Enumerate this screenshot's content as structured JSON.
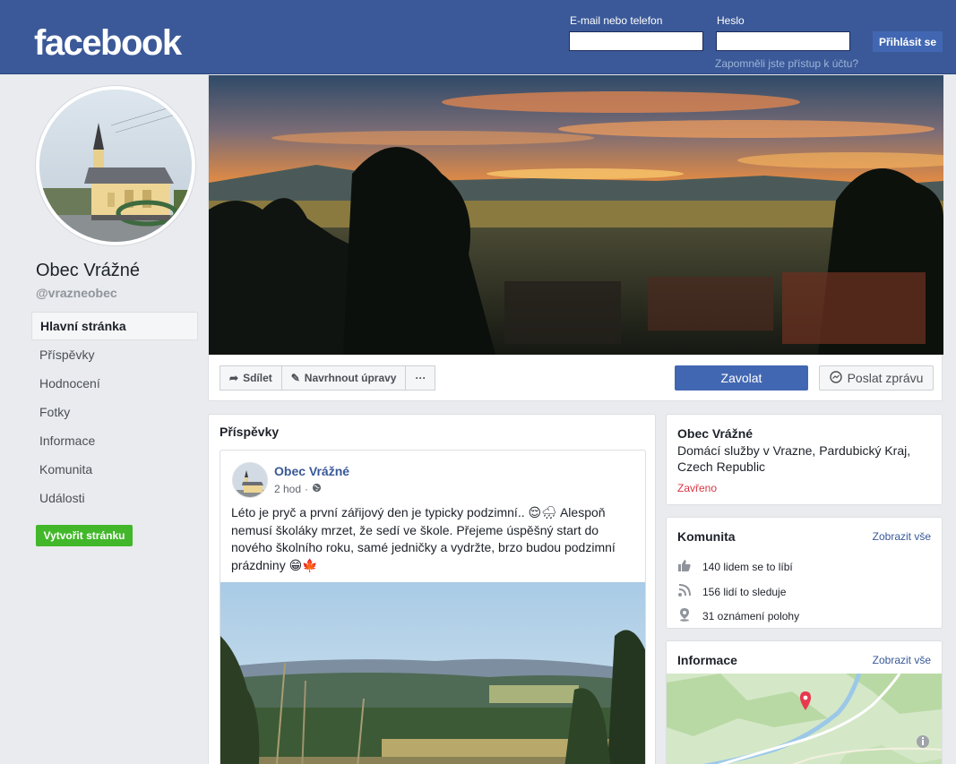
{
  "header": {
    "logo": "facebook",
    "email_label": "E-mail nebo telefon",
    "password_label": "Heslo",
    "login_button": "Přihlásit se",
    "forgot_link": "Zapomněli jste přístup k účtu?",
    "email_value": "",
    "password_value": ""
  },
  "page": {
    "name": "Obec Vrážné",
    "handle": "@vrazneobec"
  },
  "sidebar": {
    "items": [
      {
        "label": "Hlavní stránka",
        "active": true
      },
      {
        "label": "Příspěvky"
      },
      {
        "label": "Hodnocení"
      },
      {
        "label": "Fotky"
      },
      {
        "label": "Informace"
      },
      {
        "label": "Komunita"
      },
      {
        "label": "Události"
      }
    ],
    "create_button": "Vytvořit stránku"
  },
  "actions": {
    "share": "Sdílet",
    "suggest": "Navrhnout úpravy",
    "more": "···",
    "call": "Zavolat",
    "message": "Poslat zprávu"
  },
  "posts": {
    "title": "Příspěvky",
    "items": [
      {
        "author": "Obec Vrážné",
        "time": "2 hod",
        "text": "Léto je pryč a první zářijový den je typicky podzimní.. 😌🌧 Alespoň nemusí školáky mrzet, že sedí ve škole. Přejeme úspěšný start do nového školního roku, samé jedničky a vydržte, brzo budou podzimní prázdniny 😁🍁"
      }
    ]
  },
  "about": {
    "name": "Obec Vrážné",
    "description": "Domácí služby v Vrazne, Pardubický Kraj, Czech Republic",
    "status": "Zavřeno"
  },
  "community": {
    "title": "Komunita",
    "see_all": "Zobrazit vše",
    "likes": "140 lidem se to líbí",
    "follows": "156 lidí to sleduje",
    "checkins": "31 oznámení polohy"
  },
  "info": {
    "title": "Informace",
    "see_all": "Zobrazit vše"
  },
  "colors": {
    "brand": "#3b5998",
    "button_blue": "#4267b2",
    "link": "#385898",
    "create_green": "#42b72a",
    "closed_red": "#d93444"
  }
}
